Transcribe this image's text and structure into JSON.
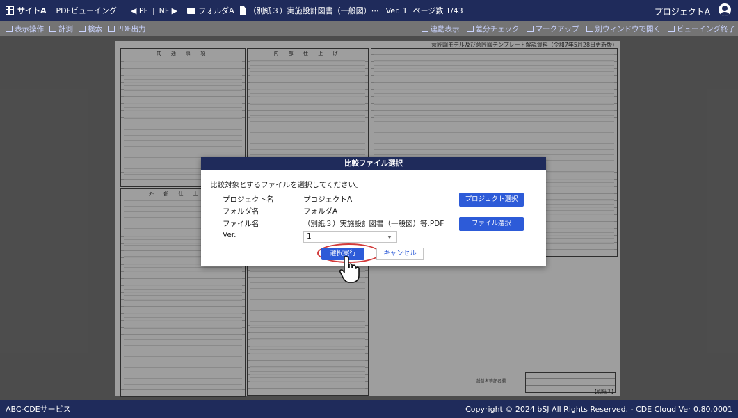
{
  "topbar": {
    "brand": "サイトA",
    "pdf_viewing": "PDFビューイング",
    "pf": "◀ PF",
    "divider": "|",
    "nf": "NF ▶",
    "folder": "フォルダA",
    "file": "（別紙３）実施設計図書（一般図）⋯",
    "version": "Ver. 1",
    "pages": "ページ数 1/43",
    "project": "プロジェクトA"
  },
  "toolbar": {
    "left": [
      "表示操作",
      "計測",
      "検索",
      "PDF出力"
    ],
    "right": [
      "連動表示",
      "差分チェック",
      "マークアップ",
      "別ウィンドウで開く",
      "ビューイング終了"
    ]
  },
  "document": {
    "header_note": "意匠図モデル及び意匠図テンプレート解説資料（令和7年5月28日更新版）",
    "col1_title": "共 通 事 項",
    "col2_title": "内 部 仕 上 げ",
    "col3_title": "外 部 仕 上 げ",
    "stamp_label": "設計者等記名欄",
    "sheet_no": "【別紙３】"
  },
  "modal": {
    "title": "比較ファイル選択",
    "instruction": "比較対象とするファイルを選択してください。",
    "project_label": "プロジェクト名",
    "project_value": "プロジェクトA",
    "folder_label": "フォルダ名",
    "folder_value": "フォルダA",
    "file_label": "ファイル名",
    "file_value": "（別紙３）実施設計図書（一般図）等.PDF",
    "ver_label": "Ver.",
    "ver_value": "1",
    "project_select_btn": "プロジェクト選択",
    "file_select_btn": "ファイル選択",
    "exec_btn": "選択実行",
    "cancel_btn": "キャンセル"
  },
  "footer": {
    "left": "ABC-CDEサービス",
    "right": "Copyright © 2024 bSJ All Rights Reserved. - CDE Cloud Ver 0.80.0001"
  },
  "colors": {
    "navy": "#1f2b5b",
    "accent_blue": "#2d5bd8",
    "highlight_red": "#d23a3a"
  }
}
